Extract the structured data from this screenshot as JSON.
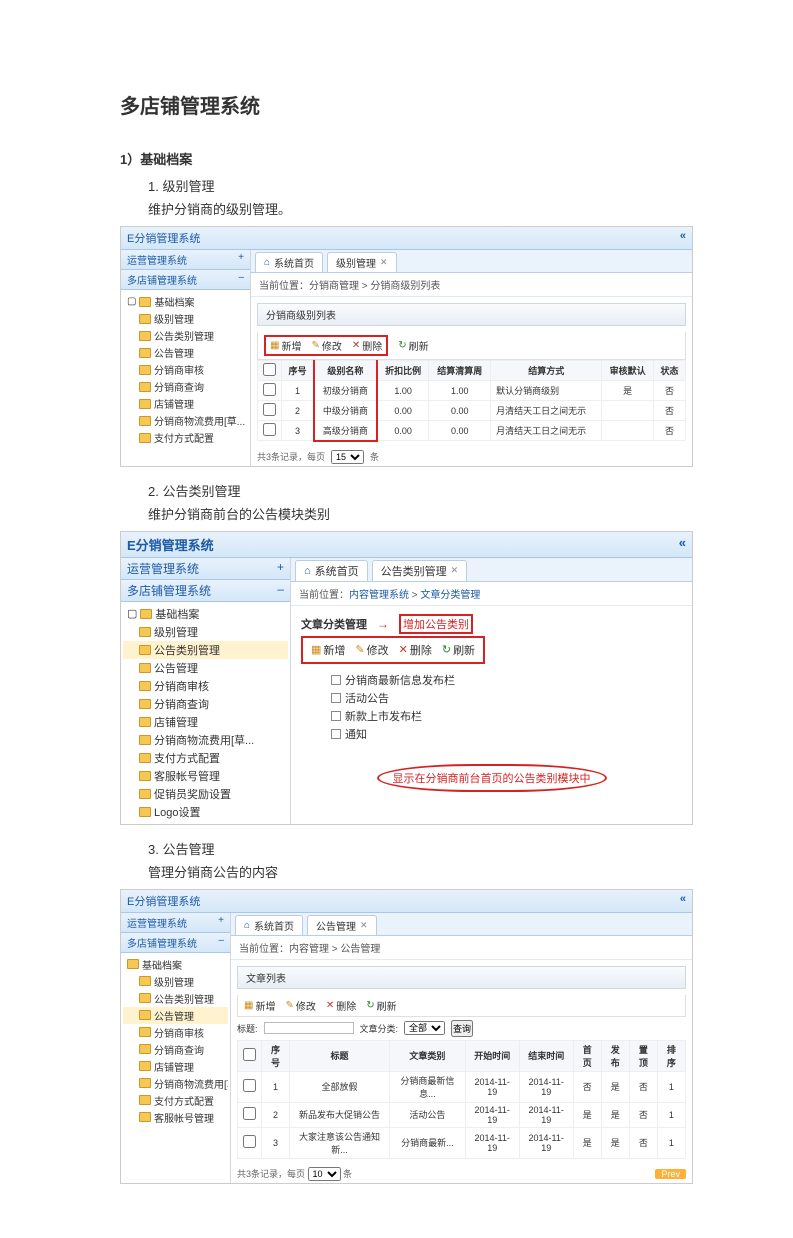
{
  "doc": {
    "title": "多店铺管理系统",
    "section1_head": "1）基础档案",
    "s1_1_title": "1.   级别管理",
    "s1_1_desc": "维护分销商的级别管理。",
    "s1_2_title": "2.   公告类别管理",
    "s1_2_desc": "维护分销商前台的公告模块类别",
    "s1_3_title": "3.   公告管理",
    "s1_3_desc": "管理分销商公告的内容"
  },
  "menu_items": {
    "level": "级别管理",
    "cat": "公告类别管理",
    "notice": "公告管理",
    "audit": "分销商审核",
    "query": "分销商查询",
    "store": "店铺管理",
    "fee": "分销商物流费用[草...",
    "pay": "支付方式配置",
    "svc": "客服帐号管理",
    "reward": "促销员奖励设置",
    "logo": "Logo设置"
  },
  "shared": {
    "system_title": "E分销管理系统",
    "nav_ops": "运营管理系统",
    "nav_multi": "多店铺管理系统",
    "tree_root": "基础档案",
    "tab_home": "系统首页",
    "btn_add": "新增",
    "btn_edit": "修改",
    "btn_del": "删除",
    "btn_ref": "刷新"
  },
  "shot1": {
    "tab2": "级别管理",
    "crumb": "当前位置：分销商管理 > 分销商级别列表",
    "panel": "分销商级别列表",
    "col_num": "序号",
    "col_name": "级别名称",
    "col_discount": "折扣比例",
    "col_days": "结算清算周",
    "col_method": "结算方式",
    "col_default": "审核默认",
    "col_op": "状态",
    "rows": [
      {
        "n": "1",
        "name": "初级分销商",
        "d": "1.00",
        "days": "1.00",
        "m": "默认分销商级别",
        "def": "是",
        "op": "否"
      },
      {
        "n": "2",
        "name": "中级分销商",
        "d": "0.00",
        "days": "0.00",
        "m": "月清结天工日之间无示",
        "def": "",
        "op": "否"
      },
      {
        "n": "3",
        "name": "高级分销商",
        "d": "0.00",
        "days": "0.00",
        "m": "月清结天工日之间无示",
        "def": "",
        "op": "否"
      }
    ],
    "pager_left": "共3条记录，每页",
    "pager_opt": "15",
    "pager_right": "条"
  },
  "shot2": {
    "tab2": "公告类别管理",
    "crumb_pre": "当前位置：",
    "crumb_a": "内容管理系统",
    "crumb_sep": " > ",
    "crumb_b": "文章分类管理",
    "panel": "文章分类管理",
    "annot_add": "增加公告类别",
    "cats": [
      "分销商最新信息发布栏",
      "活动公告",
      "新款上市发布栏",
      "通知"
    ],
    "callout": "显示在分销商前台首页的公告类别模块中"
  },
  "shot3": {
    "tab2": "公告管理",
    "crumb": "当前位置：内容管理 > 公告管理",
    "panel": "文章列表",
    "search_label": "标题:",
    "search_btn": "查询",
    "type_label": "文章分类:",
    "type_all": "全部",
    "col_num": "序号",
    "col_title": "标题",
    "col_cat": "文章类别",
    "col_start": "开始时间",
    "col_end": "结束时间",
    "col_within": "首页",
    "col_pub": "发布",
    "col_top": "置顶",
    "col_sort": "排序",
    "rows": [
      {
        "n": "1",
        "t": "全部放假",
        "c": "分销商最新信息...",
        "s": "2014-11-19",
        "e": "2014-11-19",
        "w": "否",
        "p": "是",
        "top": "否",
        "sort": "1"
      },
      {
        "n": "2",
        "t": "新品发布大促销公告",
        "c": "活动公告",
        "s": "2014-11-19",
        "e": "2014-11-19",
        "w": "是",
        "p": "是",
        "top": "否",
        "sort": "1"
      },
      {
        "n": "3",
        "t": "大家注意该公告通知新...",
        "c": "分销商最新...",
        "s": "2014-11-19",
        "e": "2014-11-19",
        "w": "是",
        "p": "是",
        "top": "否",
        "sort": "1"
      }
    ],
    "pager_info": "共3条记录，每页",
    "pager_opt": "10",
    "pager_right": "条",
    "pager_btn": "Prev"
  }
}
